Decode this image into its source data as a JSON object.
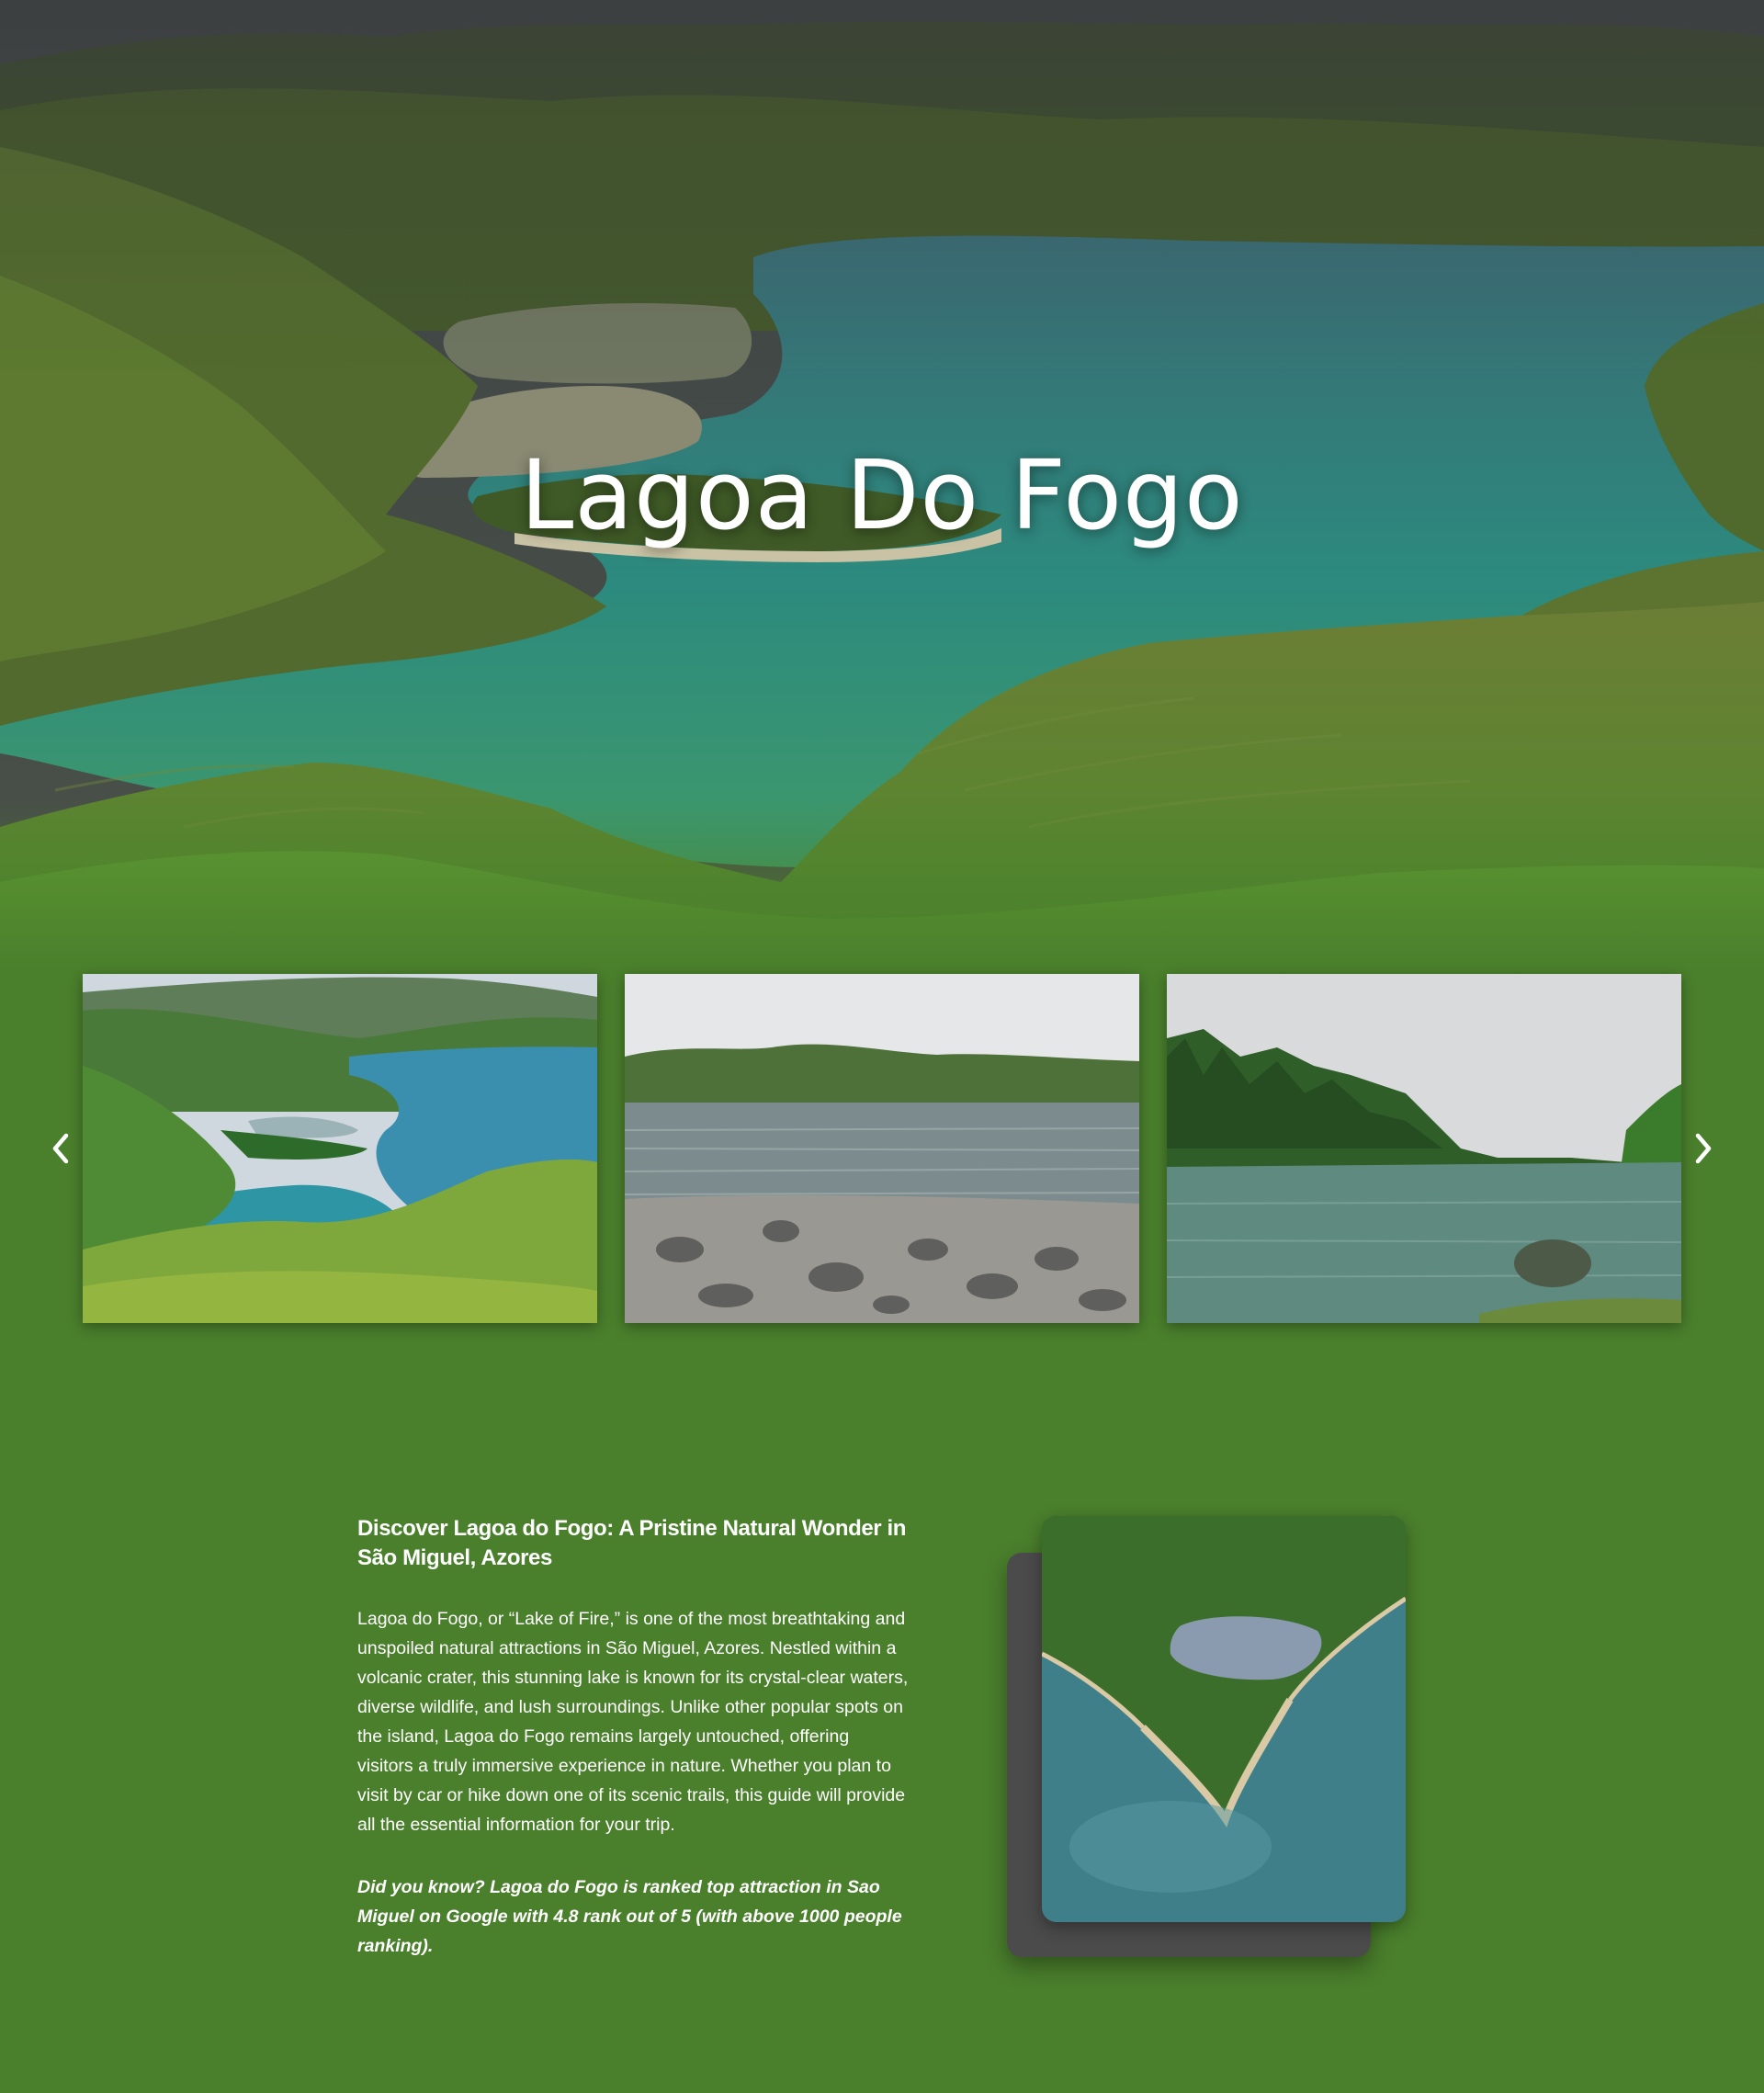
{
  "hero": {
    "title": "Lagoa Do Fogo"
  },
  "carousel": {
    "prev_icon": "chevron-left-icon",
    "next_icon": "chevron-right-icon",
    "slides": [
      {
        "subject": "lake-overview-photo"
      },
      {
        "subject": "rocky-shore-photo"
      },
      {
        "subject": "forested-shore-photo"
      }
    ]
  },
  "article": {
    "title": "Discover Lagoa do Fogo: A Pristine Natural Wonder in São Miguel, Azores",
    "body": "Lagoa do Fogo, or “Lake of Fire,” is one of the most breathtaking and unspoiled natural attractions in São Miguel, Azores. Nestled within a volcanic crater, this stunning lake is known for its crystal-clear waters, diverse wildlife, and lush surroundings. Unlike other popular spots on the island, Lagoa do Fogo remains largely untouched, offering visitors a truly immersive experience in nature. Whether you plan to visit by car or hike down one of its scenic trails, this guide will provide all the essential information for your trip.",
    "fact": "Did you know? Lagoa do Fogo is ranked top attraction in Sao Miguel on Google with 4.8 rank out of 5 (with above 1000 people ranking)."
  },
  "colors": {
    "page_background": "#4a7f2c",
    "text": "#ffffff",
    "lake": "#2f8f82",
    "card_shadow": "#4b4b4b"
  }
}
